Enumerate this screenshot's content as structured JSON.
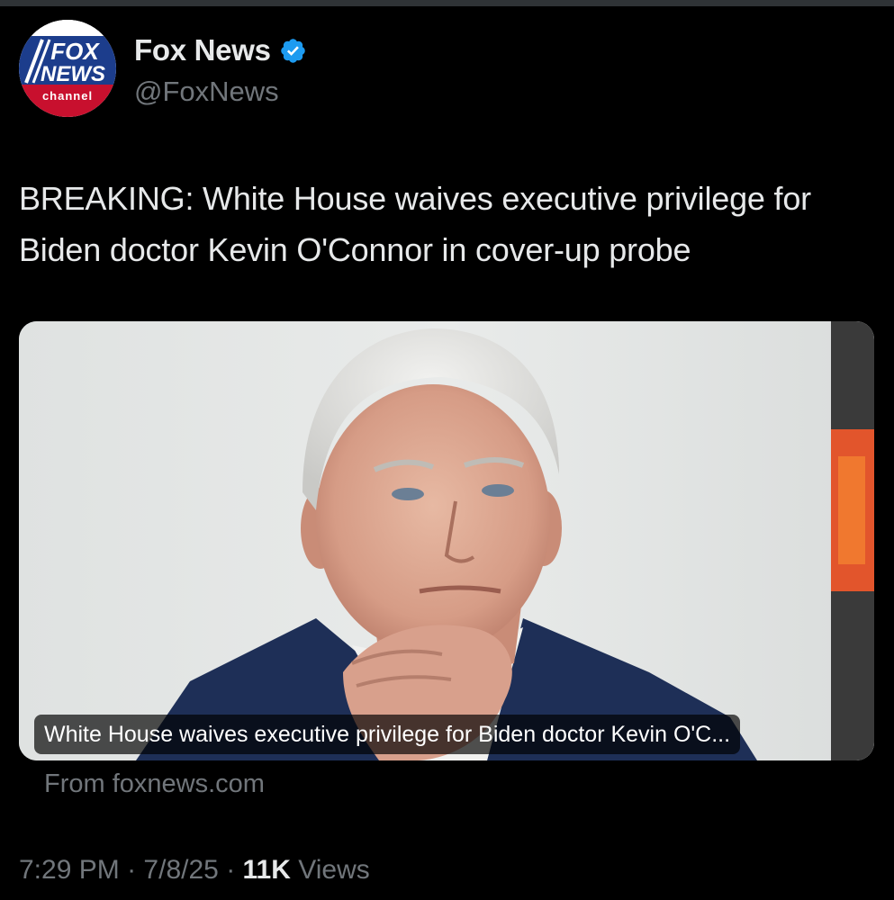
{
  "tweet": {
    "avatar_text": {
      "line1": "FOX",
      "line2": "NEWS",
      "line3": "channel"
    },
    "author": {
      "display_name": "Fox News",
      "handle": "@FoxNews"
    },
    "text": "BREAKING: White House waives executive privilege for Biden doctor Kevin O'Connor in cover-up probe",
    "card": {
      "title": "White House waives executive privilege for Biden doctor Kevin O'C...",
      "source": "From foxnews.com"
    },
    "meta": {
      "time": "7:29 PM",
      "separator": "·",
      "date": "7/8/25",
      "views_count": "11K",
      "views_label": "Views"
    }
  },
  "colors": {
    "background": "#000000",
    "primary_text": "#e7e9ea",
    "secondary_text": "#71767b",
    "verified": "#1d9bf0",
    "fox_blue": "#1c3d8c",
    "fox_red": "#c8102e"
  },
  "icons": {
    "verified": "verified-badge-icon",
    "avatar": "fox-news-channel-logo"
  }
}
